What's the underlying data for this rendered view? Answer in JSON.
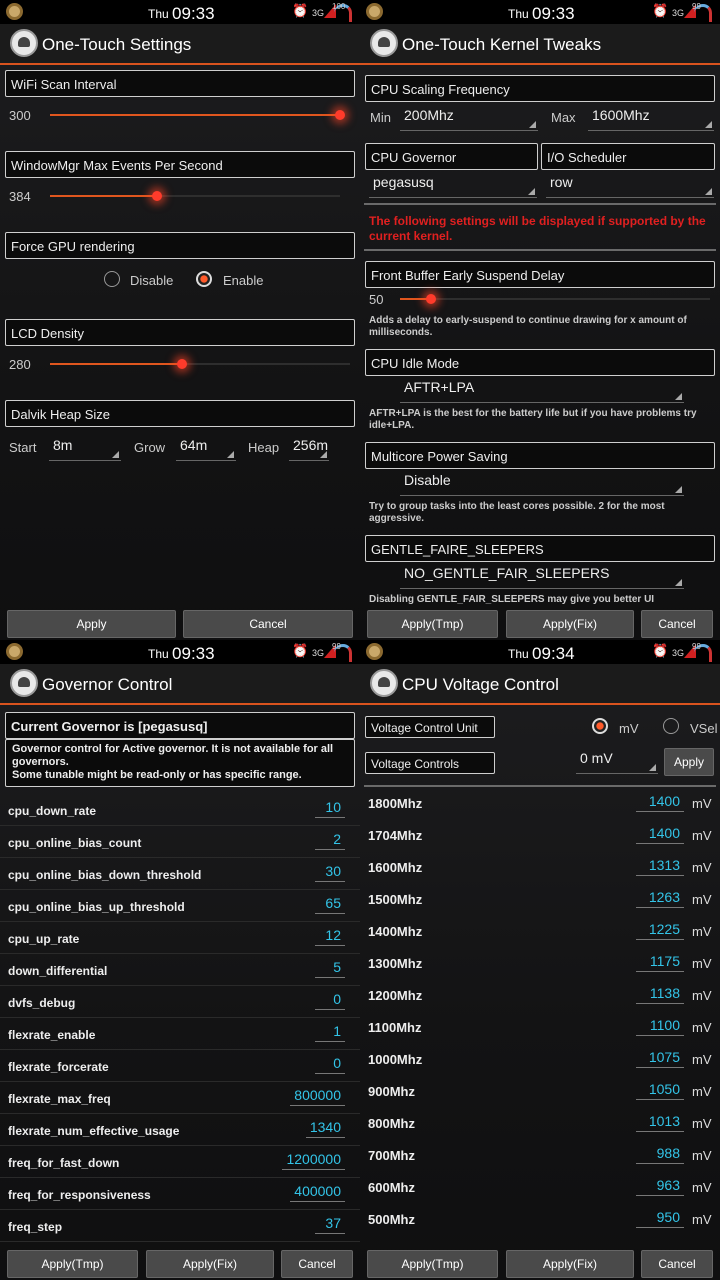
{
  "status": {
    "day": "Thu",
    "times": [
      "09:33",
      "09:33",
      "09:33",
      "09:34"
    ],
    "net": "3G",
    "battery": [
      "100",
      "99",
      "99",
      "99"
    ]
  },
  "p1": {
    "title": "One-Touch Settings",
    "wifi": {
      "label": "WiFi Scan Interval",
      "value": "300",
      "fraction": 1.0
    },
    "wm": {
      "label": "WindowMgr Max Events Per Second",
      "value": "384",
      "fraction": 0.37
    },
    "gpu": {
      "label": "Force GPU rendering",
      "disable": "Disable",
      "enable": "Enable",
      "selected": "enable"
    },
    "lcd": {
      "label": "LCD Density",
      "value": "280",
      "fraction": 0.44
    },
    "heap": {
      "label": "Dalvik Heap Size",
      "start_label": "Start",
      "start": "8m",
      "grow_label": "Grow",
      "grow": "64m",
      "heap_label": "Heap",
      "heap": "256m"
    },
    "apply": "Apply",
    "cancel": "Cancel"
  },
  "p2": {
    "title": "One-Touch Kernel Tweaks",
    "scaling": "CPU Scaling Frequency",
    "min_label": "Min",
    "min": "200Mhz",
    "max_label": "Max",
    "max": "1600Mhz",
    "governor_label": "CPU Governor",
    "governor": "pegasusq",
    "io_label": "I/O Scheduler",
    "io": "row",
    "warning": "The following settings will be displayed if supported by the current kernel.",
    "fbesd": {
      "label": "Front Buffer Early Suspend Delay",
      "value": "50",
      "fraction": 0.1,
      "note": "Adds a delay to early-suspend to continue drawing for x amount of milliseconds."
    },
    "idle": {
      "label": "CPU Idle Mode",
      "value": "AFTR+LPA",
      "note": "AFTR+LPA is the best for the battery life but if you have problems try idle+LPA."
    },
    "mps": {
      "label": "Multicore Power Saving",
      "value": "Disable",
      "note": "Try to group tasks into the least cores possible. 2 for the most aggressive."
    },
    "gfs": {
      "label": "GENTLE_FAIRE_SLEEPERS",
      "value": "NO_GENTLE_FAIR_SLEEPERS",
      "note": "Disabling GENTLE_FAIR_SLEEPERS may give you better UI"
    },
    "apply_tmp": "Apply(Tmp)",
    "apply_fix": "Apply(Fix)",
    "cancel": "Cancel"
  },
  "p3": {
    "title": "Governor Control",
    "current": "Current Governor is [pegasusq]",
    "info": "Governor control for Active governor. It is not available for all governors.\nSome tunable might be read-only or has specific range.",
    "rows": [
      {
        "k": "cpu_down_rate",
        "v": "10"
      },
      {
        "k": "cpu_online_bias_count",
        "v": "2"
      },
      {
        "k": "cpu_online_bias_down_threshold",
        "v": "30"
      },
      {
        "k": "cpu_online_bias_up_threshold",
        "v": "65"
      },
      {
        "k": "cpu_up_rate",
        "v": "12"
      },
      {
        "k": "down_differential",
        "v": "5"
      },
      {
        "k": "dvfs_debug",
        "v": "0"
      },
      {
        "k": "flexrate_enable",
        "v": "1"
      },
      {
        "k": "flexrate_forcerate",
        "v": "0"
      },
      {
        "k": "flexrate_max_freq",
        "v": "800000"
      },
      {
        "k": "flexrate_num_effective_usage",
        "v": "1340"
      },
      {
        "k": "freq_for_fast_down",
        "v": "1200000"
      },
      {
        "k": "freq_for_responsiveness",
        "v": "400000"
      },
      {
        "k": "freq_step",
        "v": "37"
      }
    ],
    "apply_tmp": "Apply(Tmp)",
    "apply_fix": "Apply(Fix)",
    "cancel": "Cancel"
  },
  "p4": {
    "title": "CPU Voltage Control",
    "unit_label": "Voltage Control Unit",
    "mv": "mV",
    "vsel": "VSel",
    "unit_selected": "mv",
    "controls_label": "Voltage Controls",
    "controls_value": "0 mV",
    "apply": "Apply",
    "unit": "mV",
    "rows": [
      {
        "k": "1800Mhz",
        "v": "1400"
      },
      {
        "k": "1704Mhz",
        "v": "1400"
      },
      {
        "k": "1600Mhz",
        "v": "1313"
      },
      {
        "k": "1500Mhz",
        "v": "1263"
      },
      {
        "k": "1400Mhz",
        "v": "1225"
      },
      {
        "k": "1300Mhz",
        "v": "1175"
      },
      {
        "k": "1200Mhz",
        "v": "1138"
      },
      {
        "k": "1100Mhz",
        "v": "1100"
      },
      {
        "k": "1000Mhz",
        "v": "1075"
      },
      {
        "k": "900Mhz",
        "v": "1050"
      },
      {
        "k": "800Mhz",
        "v": "1013"
      },
      {
        "k": "700Mhz",
        "v": "988"
      },
      {
        "k": "600Mhz",
        "v": "963"
      },
      {
        "k": "500Mhz",
        "v": "950"
      }
    ],
    "apply_tmp": "Apply(Tmp)",
    "apply_fix": "Apply(Fix)",
    "cancel": "Cancel"
  }
}
